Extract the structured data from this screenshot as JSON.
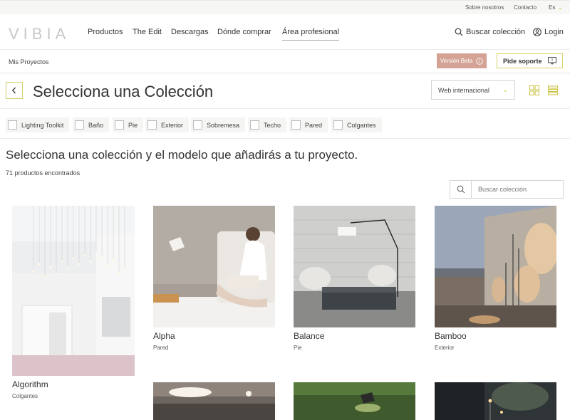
{
  "topbar": {
    "about": "Sobre nosotros",
    "contact": "Contacto",
    "lang": "Es"
  },
  "header": {
    "logo": "VIBIA",
    "nav": [
      "Productos",
      "The Edit",
      "Descargas",
      "Dónde comprar",
      "Área profesional"
    ],
    "search_label": "Buscar colección",
    "login_label": "Login"
  },
  "subbar": {
    "breadcrumb": "Mis Proyectos",
    "beta_label": "Versión Beta",
    "support_label": "Pide soporte"
  },
  "title": {
    "text": "Selecciona una Colección",
    "region_select": "Web internacional"
  },
  "filters": [
    "Lighting Toolkit",
    "Baño",
    "Pie",
    "Exterior",
    "Sobremesa",
    "Techo",
    "Pared",
    "Colgantes"
  ],
  "content": {
    "headline": "Selecciona una colección y el modelo que añadirás a tu proyecto.",
    "count": "71 productos encontrados",
    "search_placeholder": "Buscar colección"
  },
  "products": [
    {
      "name": "Algorithm",
      "category": "Colgantes"
    },
    {
      "name": "Alpha",
      "category": "Pared"
    },
    {
      "name": "Balance",
      "category": "Pie"
    },
    {
      "name": "Bamboo",
      "category": "Exterior"
    }
  ],
  "colors": {
    "accent": "#c9c13a",
    "beta": "#d4a395"
  }
}
